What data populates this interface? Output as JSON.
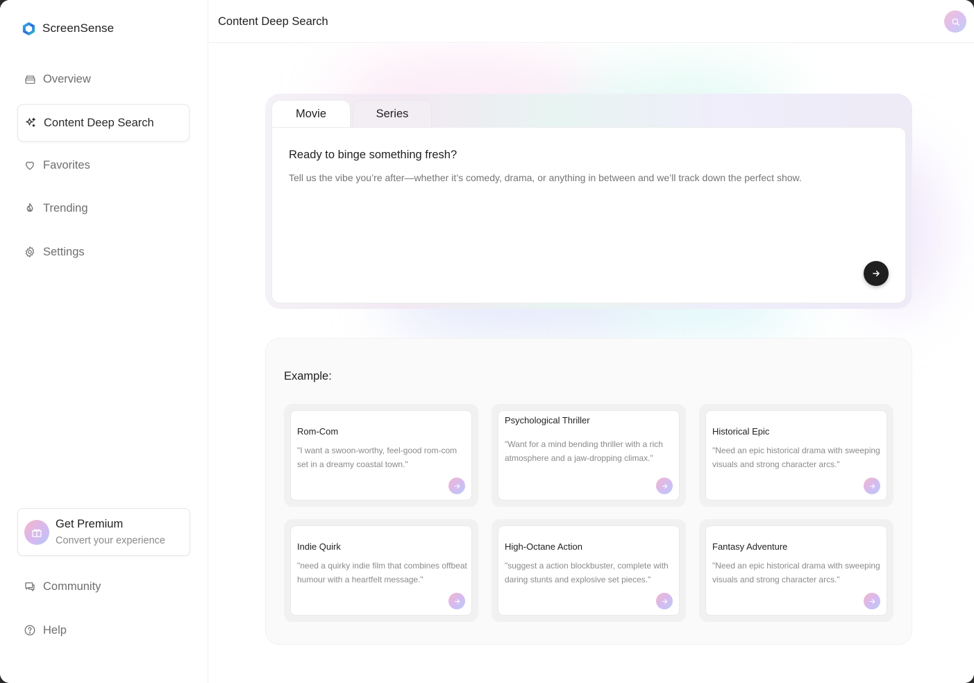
{
  "app": {
    "name": "ScreenSense",
    "accent_color": "#1f1f1f"
  },
  "sidebar": {
    "items": [
      {
        "label": "Overview",
        "icon": "archive-icon"
      },
      {
        "label": "Content Deep Search",
        "icon": "sparkles-icon",
        "active": true
      },
      {
        "label": "Favorites",
        "icon": "heart-icon"
      },
      {
        "label": "Trending",
        "icon": "flame-icon"
      },
      {
        "label": "Settings",
        "icon": "gear-icon"
      }
    ],
    "premium": {
      "title": "Get Premium",
      "subtitle": "Convert your experience",
      "icon": "gift-icon"
    },
    "bottom_items": [
      {
        "label": "Community",
        "icon": "chat-icon"
      },
      {
        "label": "Help",
        "icon": "help-circle-icon"
      }
    ]
  },
  "header": {
    "title": "Content Deep Search",
    "avatar_icon": "search-icon"
  },
  "search": {
    "tabs": [
      {
        "label": "Movie",
        "active": true
      },
      {
        "label": "Series",
        "active": false
      }
    ],
    "heading": "Ready to binge something fresh?",
    "placeholder": "Tell us the vibe you’re after—whether it’s comedy, drama, or anything in between and we’ll track down the perfect show.",
    "send_icon": "arrow-right-icon"
  },
  "examples": {
    "title": "Example:",
    "items": [
      {
        "title": "Rom-Com",
        "desc": "\"I want a swoon-worthy, feel-good rom-com set in a dreamy coastal town.\""
      },
      {
        "title": "Psychological Thriller",
        "desc": "\"Want for a mind bending thriller with a rich atmosphere and a jaw-dropping climax.\""
      },
      {
        "title": "Historical Epic",
        "desc": "\"Need an epic historical drama with sweeping visuals and strong character arcs.\""
      },
      {
        "title": "Indie Quirk",
        "desc": "\"need a quirky indie film that combines offbeat humour with a heartfelt message.\""
      },
      {
        "title": "High-Octane Action",
        "desc": "\"suggest a action blockbuster, complete with daring stunts and explosive set pieces.\""
      },
      {
        "title": "Fantasy Adventure",
        "desc": "\"Need an epic historical drama with sweeping visuals and strong character arcs.\""
      }
    ]
  }
}
